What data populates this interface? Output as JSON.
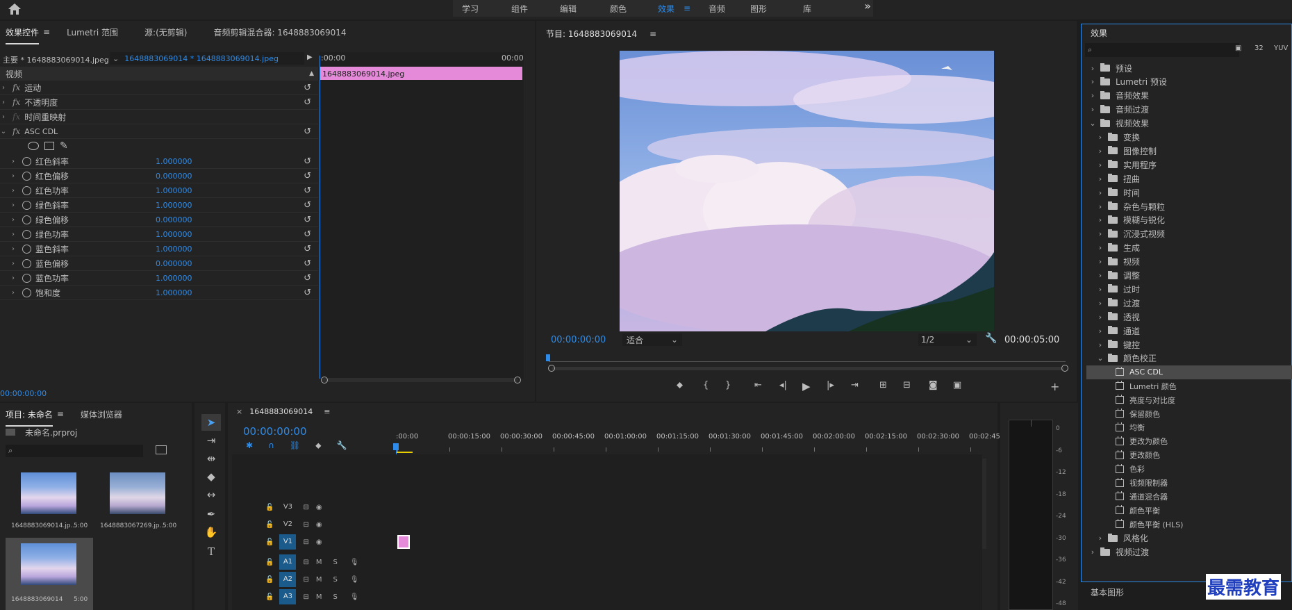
{
  "workspaces": {
    "home_icon": "home-icon",
    "items": [
      "学习",
      "组件",
      "编辑",
      "颜色",
      "效果",
      "音频",
      "图形",
      "库"
    ],
    "active": "效果",
    "more": "»"
  },
  "effect_controls": {
    "tabs": [
      "效果控件",
      "Lumetri 范围",
      "源:(无剪辑)",
      "音频剪辑混合器: 1648883069014"
    ],
    "master_label": "主要 * 1648883069014.jpeg",
    "sequence_label": "1648883069014 * 1648883069014.jpeg",
    "timecode_start": ":00:00",
    "timecode_end": "00:00",
    "clip_name": "1648883069014.jpeg",
    "video_header": "视频",
    "effects": [
      {
        "name": "运动"
      },
      {
        "name": "不透明度"
      },
      {
        "name": "时间重映射"
      },
      {
        "name": "ASC CDL"
      }
    ],
    "params": [
      {
        "name": "红色斜率",
        "value": "1.000000"
      },
      {
        "name": "红色偏移",
        "value": "0.000000"
      },
      {
        "name": "红色功率",
        "value": "1.000000"
      },
      {
        "name": "绿色斜率",
        "value": "1.000000"
      },
      {
        "name": "绿色偏移",
        "value": "0.000000"
      },
      {
        "name": "绿色功率",
        "value": "1.000000"
      },
      {
        "name": "蓝色斜率",
        "value": "1.000000"
      },
      {
        "name": "蓝色偏移",
        "value": "0.000000"
      },
      {
        "name": "蓝色功率",
        "value": "1.000000"
      },
      {
        "name": "饱和度",
        "value": "1.000000"
      }
    ],
    "footer_timecode": "00:00:00:00"
  },
  "program_monitor": {
    "title": "节目: 1648883069014",
    "timecode": "00:00:00:00",
    "fit": "适合",
    "resolution": "1/2",
    "duration": "00:00:05:00"
  },
  "effects_panel": {
    "title": "效果",
    "tree": [
      {
        "label": "预设",
        "level": 0,
        "kind": "folder",
        "open": false
      },
      {
        "label": "Lumetri 预设",
        "level": 0,
        "kind": "folder",
        "open": false
      },
      {
        "label": "音频效果",
        "level": 0,
        "kind": "folder",
        "open": false
      },
      {
        "label": "音频过渡",
        "level": 0,
        "kind": "folder",
        "open": false
      },
      {
        "label": "视频效果",
        "level": 0,
        "kind": "folder",
        "open": true
      },
      {
        "label": "变换",
        "level": 1,
        "kind": "folder",
        "open": false
      },
      {
        "label": "图像控制",
        "level": 1,
        "kind": "folder",
        "open": false
      },
      {
        "label": "实用程序",
        "level": 1,
        "kind": "folder",
        "open": false
      },
      {
        "label": "扭曲",
        "level": 1,
        "kind": "folder",
        "open": false
      },
      {
        "label": "时间",
        "level": 1,
        "kind": "folder",
        "open": false
      },
      {
        "label": "杂色与颗粒",
        "level": 1,
        "kind": "folder",
        "open": false
      },
      {
        "label": "模糊与锐化",
        "level": 1,
        "kind": "folder",
        "open": false
      },
      {
        "label": "沉浸式视频",
        "level": 1,
        "kind": "folder",
        "open": false
      },
      {
        "label": "生成",
        "level": 1,
        "kind": "folder",
        "open": false
      },
      {
        "label": "视频",
        "level": 1,
        "kind": "folder",
        "open": false
      },
      {
        "label": "调整",
        "level": 1,
        "kind": "folder",
        "open": false
      },
      {
        "label": "过时",
        "level": 1,
        "kind": "folder",
        "open": false
      },
      {
        "label": "过渡",
        "level": 1,
        "kind": "folder",
        "open": false
      },
      {
        "label": "透视",
        "level": 1,
        "kind": "folder",
        "open": false
      },
      {
        "label": "通道",
        "level": 1,
        "kind": "folder",
        "open": false
      },
      {
        "label": "键控",
        "level": 1,
        "kind": "folder",
        "open": false
      },
      {
        "label": "颜色校正",
        "level": 1,
        "kind": "folder",
        "open": true
      },
      {
        "label": "ASC CDL",
        "level": 2,
        "kind": "effect",
        "selected": true
      },
      {
        "label": "Lumetri 颜色",
        "level": 2,
        "kind": "effect"
      },
      {
        "label": "亮度与对比度",
        "level": 2,
        "kind": "effect"
      },
      {
        "label": "保留颜色",
        "level": 2,
        "kind": "effect"
      },
      {
        "label": "均衡",
        "level": 2,
        "kind": "effect"
      },
      {
        "label": "更改为颜色",
        "level": 2,
        "kind": "effect"
      },
      {
        "label": "更改颜色",
        "level": 2,
        "kind": "effect"
      },
      {
        "label": "色彩",
        "level": 2,
        "kind": "effect"
      },
      {
        "label": "视频限制器",
        "level": 2,
        "kind": "effect"
      },
      {
        "label": "通道混合器",
        "level": 2,
        "kind": "effect"
      },
      {
        "label": "颜色平衡",
        "level": 2,
        "kind": "effect"
      },
      {
        "label": "颜色平衡 (HLS)",
        "level": 2,
        "kind": "effect"
      },
      {
        "label": "风格化",
        "level": 1,
        "kind": "folder",
        "open": false
      },
      {
        "label": "视频过渡",
        "level": 0,
        "kind": "folder",
        "open": false
      }
    ],
    "basic_graphics": "基本图形",
    "watermark": "最需教育"
  },
  "project": {
    "tabs": [
      "项目: 未命名",
      "媒体浏览器"
    ],
    "file": "未命名.prproj",
    "items": [
      {
        "name": "1648883069014.jp...",
        "duration": "5:00"
      },
      {
        "name": "1648883067269.jp...",
        "duration": "5:00"
      },
      {
        "name": "1648883069014",
        "duration": "5:00"
      }
    ]
  },
  "timeline": {
    "tab": "1648883069014",
    "timecode": "00:00:00:00",
    "ruler": [
      ":00:00",
      "00:00:15:00",
      "00:00:30:00",
      "00:00:45:00",
      "00:01:00:00",
      "00:01:15:00",
      "00:01:30:00",
      "00:01:45:00",
      "00:02:00:00",
      "00:02:15:00",
      "00:02:30:00",
      "00:02:45:"
    ],
    "video_tracks": [
      "V3",
      "V2",
      "V1"
    ],
    "audio_tracks": [
      "A1",
      "A2",
      "A3"
    ],
    "mute": "M",
    "solo": "S"
  },
  "audio_meter": {
    "labels": [
      "0",
      "-6",
      "-12",
      "-18",
      "-24",
      "-30",
      "-36",
      "-42",
      "-48"
    ]
  },
  "colors": {
    "accent": "#2d8ceb",
    "clip_pink": "#e48ad8",
    "track_active": "#1a5b8c"
  }
}
